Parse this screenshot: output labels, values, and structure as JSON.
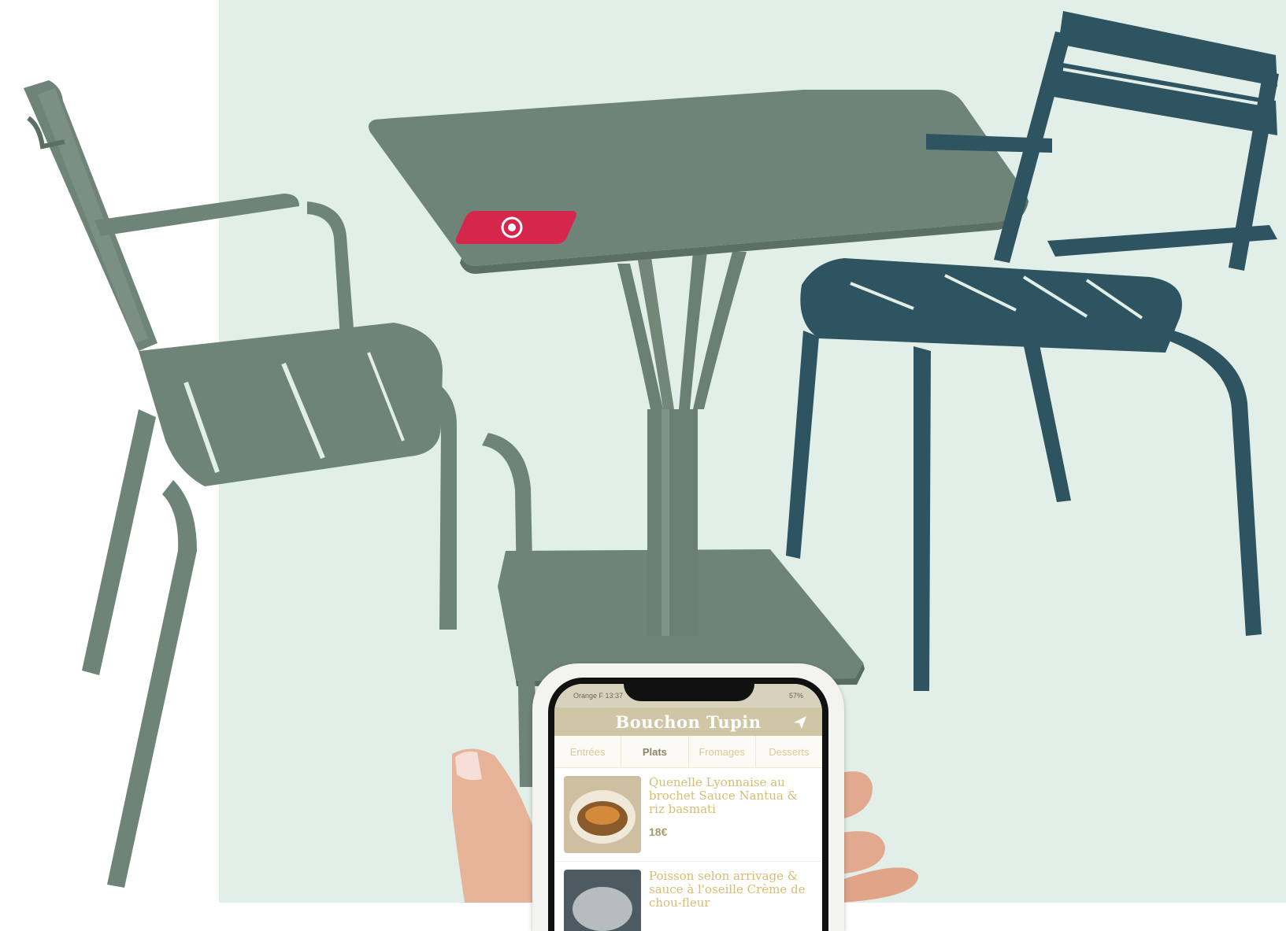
{
  "scene": {
    "colors": {
      "background": "#e2efe9",
      "grey_green_furniture": "#6f8478",
      "petrol_blue_chair": "#2e5461",
      "table_sticker": "#d7264c"
    }
  },
  "phone": {
    "status_left": "Orange F  13:37",
    "status_right": "57%",
    "app_title": "Bouchon Tupin",
    "send_icon": "paper-plane-icon",
    "tabs": [
      {
        "label": "Entrées",
        "active": false
      },
      {
        "label": "Plats",
        "active": true
      },
      {
        "label": "Fromages",
        "active": false
      },
      {
        "label": "Desserts",
        "active": false
      }
    ],
    "menu_items": [
      {
        "name": "Quenelle Lyonnaise au brochet Sauce Nantua & riz basmati",
        "price": "18€"
      },
      {
        "name": "Poisson selon arrivage & sauce à l'oseille Crème de chou-fleur",
        "price": ""
      }
    ]
  }
}
